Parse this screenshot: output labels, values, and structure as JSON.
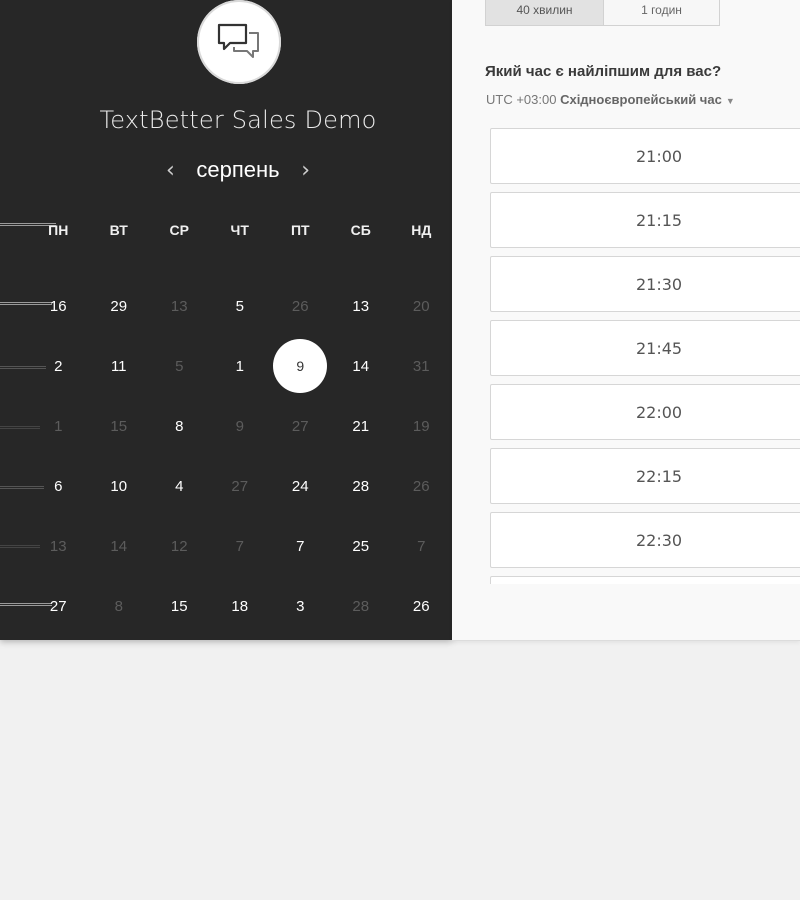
{
  "event": {
    "title": "TextBetter Sales Demo",
    "logo_icon": "chat-bubbles-icon"
  },
  "calendar": {
    "month": "серпень",
    "prev_arrow": "‹",
    "next_arrow": "›",
    "weekdays": [
      "ПН",
      "ВТ",
      "СР",
      "ЧТ",
      "ПТ",
      "СБ",
      "НД"
    ],
    "weeks": [
      [
        {
          "d": "16",
          "dim": false
        },
        {
          "d": "29",
          "dim": false
        },
        {
          "d": "13",
          "dim": true
        },
        {
          "d": "5",
          "dim": false
        },
        {
          "d": "26",
          "dim": true
        },
        {
          "d": "13",
          "dim": false
        },
        {
          "d": "20",
          "dim": true
        }
      ],
      [
        {
          "d": "2",
          "dim": false
        },
        {
          "d": "11",
          "dim": false
        },
        {
          "d": "5",
          "dim": true
        },
        {
          "d": "1",
          "dim": false
        },
        {
          "d": "9",
          "dim": false,
          "selected": true
        },
        {
          "d": "14",
          "dim": false
        },
        {
          "d": "31",
          "dim": true
        }
      ],
      [
        {
          "d": "1",
          "dim": true
        },
        {
          "d": "15",
          "dim": true
        },
        {
          "d": "8",
          "dim": false
        },
        {
          "d": "9",
          "dim": true
        },
        {
          "d": "27",
          "dim": true
        },
        {
          "d": "21",
          "dim": false
        },
        {
          "d": "19",
          "dim": true
        }
      ],
      [
        {
          "d": "6",
          "dim": false
        },
        {
          "d": "10",
          "dim": false
        },
        {
          "d": "4",
          "dim": false
        },
        {
          "d": "27",
          "dim": true
        },
        {
          "d": "24",
          "dim": false
        },
        {
          "d": "28",
          "dim": false
        },
        {
          "d": "26",
          "dim": true
        }
      ],
      [
        {
          "d": "13",
          "dim": true
        },
        {
          "d": "14",
          "dim": true
        },
        {
          "d": "12",
          "dim": true
        },
        {
          "d": "7",
          "dim": true
        },
        {
          "d": "7",
          "dim": false
        },
        {
          "d": "25",
          "dim": false
        },
        {
          "d": "7",
          "dim": true
        }
      ],
      [
        {
          "d": "27",
          "dim": false
        },
        {
          "d": "8",
          "dim": true
        },
        {
          "d": "15",
          "dim": false
        },
        {
          "d": "18",
          "dim": false
        },
        {
          "d": "3",
          "dim": false
        },
        {
          "d": "28",
          "dim": true
        },
        {
          "d": "26",
          "dim": false
        }
      ]
    ]
  },
  "duration": {
    "tabs": [
      {
        "label": "40 хвилин",
        "active": true
      },
      {
        "label": "1 годин",
        "active": false
      }
    ]
  },
  "scheduler": {
    "question": "Який час є найліпшим для вас?",
    "timezone_offset": "UTC +03:00",
    "timezone_name": "Східноєвропейський час",
    "slots": [
      "21:00",
      "21:15",
      "21:30",
      "21:45",
      "22:00",
      "22:15",
      "22:30",
      ""
    ]
  },
  "colors": {
    "panel_dark": "#272727",
    "page_bg": "#f1f1f1"
  }
}
